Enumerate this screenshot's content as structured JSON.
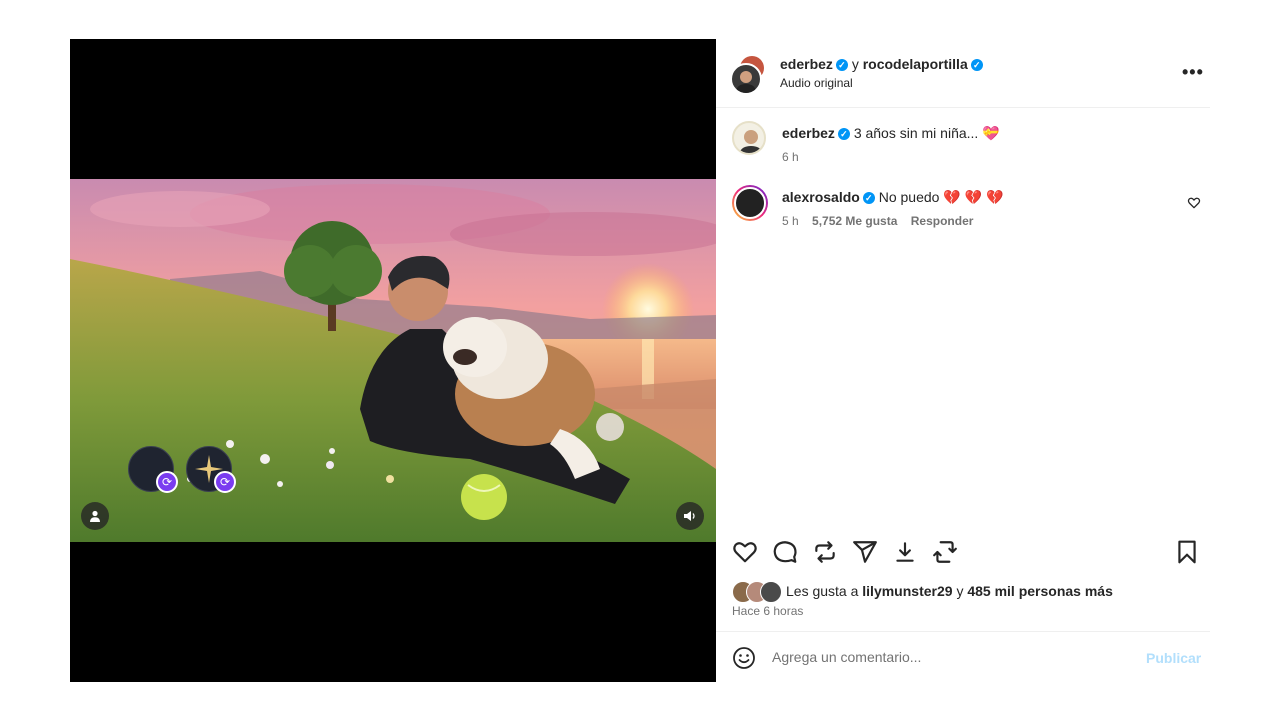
{
  "post": {
    "author": "ederbez",
    "connector": "y",
    "coauthor": "rocodelaportilla",
    "audio": "Audio original",
    "more": "•••"
  },
  "media": {
    "avatar_badge_icon": "repost-icon",
    "tagged_icon": "person-icon",
    "sound_icon": "speaker-icon"
  },
  "comments": [
    {
      "user": "ederbez",
      "text": "3 años sin mi niña... 💝",
      "time": "6 h"
    },
    {
      "user": "alexrosaldo",
      "text": "No puedo 💔 💔 💔",
      "time": "5 h",
      "likes": "5,752 Me gusta",
      "reply": "Responder"
    }
  ],
  "actions": [
    "heart-icon",
    "comment-icon",
    "repost-icon",
    "share-icon",
    "download-icon",
    "remix-icon",
    "bookmark-icon"
  ],
  "likes": {
    "prefix": "Les gusta a",
    "user": "lilymunster29",
    "connector": "y",
    "others": "485 mil personas más"
  },
  "time_ago": "Hace 6 horas",
  "composer": {
    "placeholder": "Agrega un comentario...",
    "publish": "Publicar"
  },
  "colors": {
    "verified": "#0095f6",
    "publish_disabled": "#b2dffc",
    "repost_badge": "#7a3cf0"
  }
}
